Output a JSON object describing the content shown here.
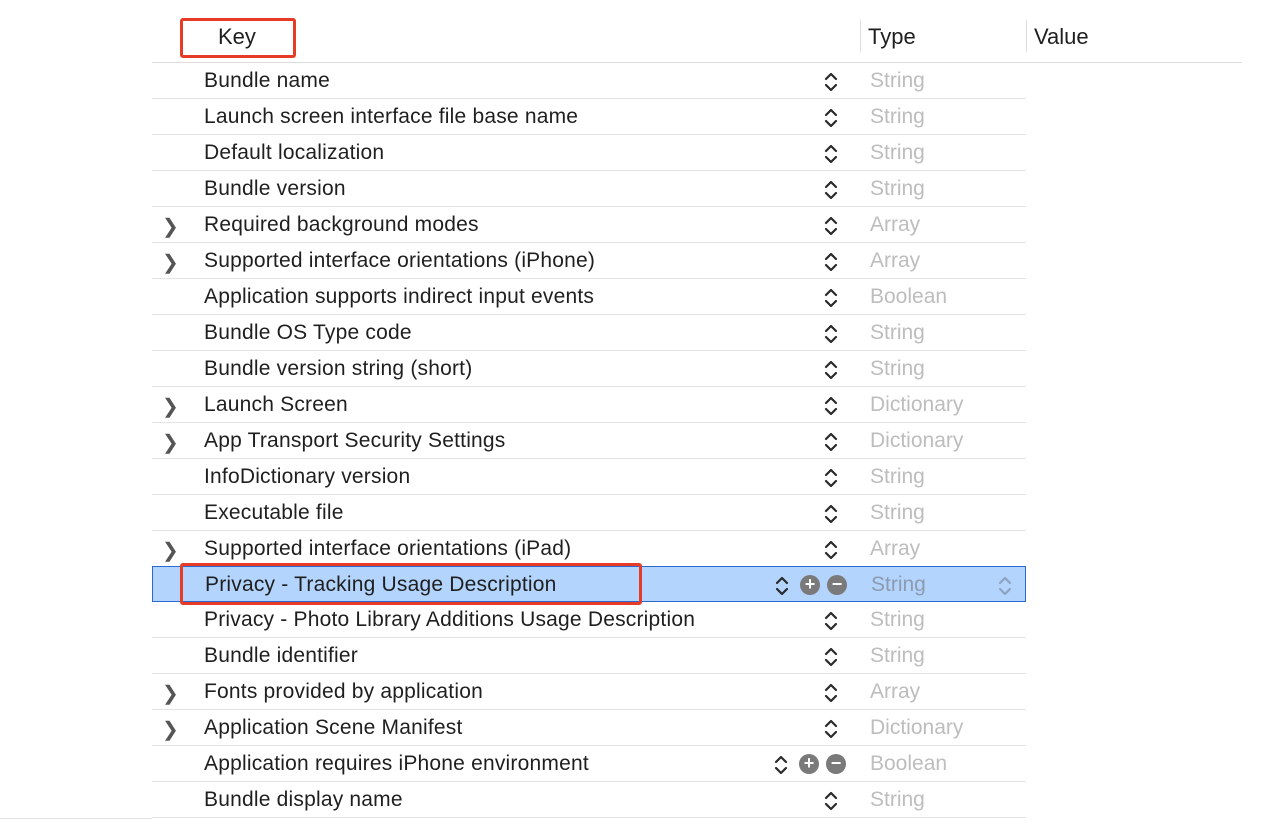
{
  "header": {
    "key": "Key",
    "type": "Type",
    "value": "Value"
  },
  "rows": [
    {
      "key": "Bundle name",
      "type": "String",
      "expandable": false
    },
    {
      "key": "Launch screen interface file base name",
      "type": "String",
      "expandable": false
    },
    {
      "key": "Default localization",
      "type": "String",
      "expandable": false
    },
    {
      "key": "Bundle version",
      "type": "String",
      "expandable": false
    },
    {
      "key": "Required background modes",
      "type": "Array",
      "expandable": true
    },
    {
      "key": "Supported interface orientations (iPhone)",
      "type": "Array",
      "expandable": true
    },
    {
      "key": "Application supports indirect input events",
      "type": "Boolean",
      "expandable": false
    },
    {
      "key": "Bundle OS Type code",
      "type": "String",
      "expandable": false
    },
    {
      "key": "Bundle version string (short)",
      "type": "String",
      "expandable": false
    },
    {
      "key": "Launch Screen",
      "type": "Dictionary",
      "expandable": true
    },
    {
      "key": "App Transport Security Settings",
      "type": "Dictionary",
      "expandable": true
    },
    {
      "key": "InfoDictionary version",
      "type": "String",
      "expandable": false
    },
    {
      "key": "Executable file",
      "type": "String",
      "expandable": false
    },
    {
      "key": "Supported interface orientations (iPad)",
      "type": "Array",
      "expandable": true
    },
    {
      "key": "Privacy - Tracking Usage Description",
      "type": "String",
      "expandable": false,
      "selected": true,
      "controls": true
    },
    {
      "key": "Privacy - Photo Library Additions Usage Description",
      "type": "String",
      "expandable": false
    },
    {
      "key": "Bundle identifier",
      "type": "String",
      "expandable": false
    },
    {
      "key": "Fonts provided by application",
      "type": "Array",
      "expandable": true
    },
    {
      "key": "Application Scene Manifest",
      "type": "Dictionary",
      "expandable": true
    },
    {
      "key": "Application requires iPhone environment",
      "type": "Boolean",
      "expandable": false,
      "controls": true
    },
    {
      "key": "Bundle display name",
      "type": "String",
      "expandable": false
    }
  ],
  "icons": {
    "disclosure": "chevron-right-icon",
    "stepper": "up-down-stepper-icon",
    "add": "plus-circle-icon",
    "remove": "minus-circle-icon"
  },
  "colors": {
    "selection": "#b3d4fd",
    "selection_border": "#2b67d1",
    "highlight_box": "#e63b26",
    "type_text": "#bdbdbd"
  }
}
